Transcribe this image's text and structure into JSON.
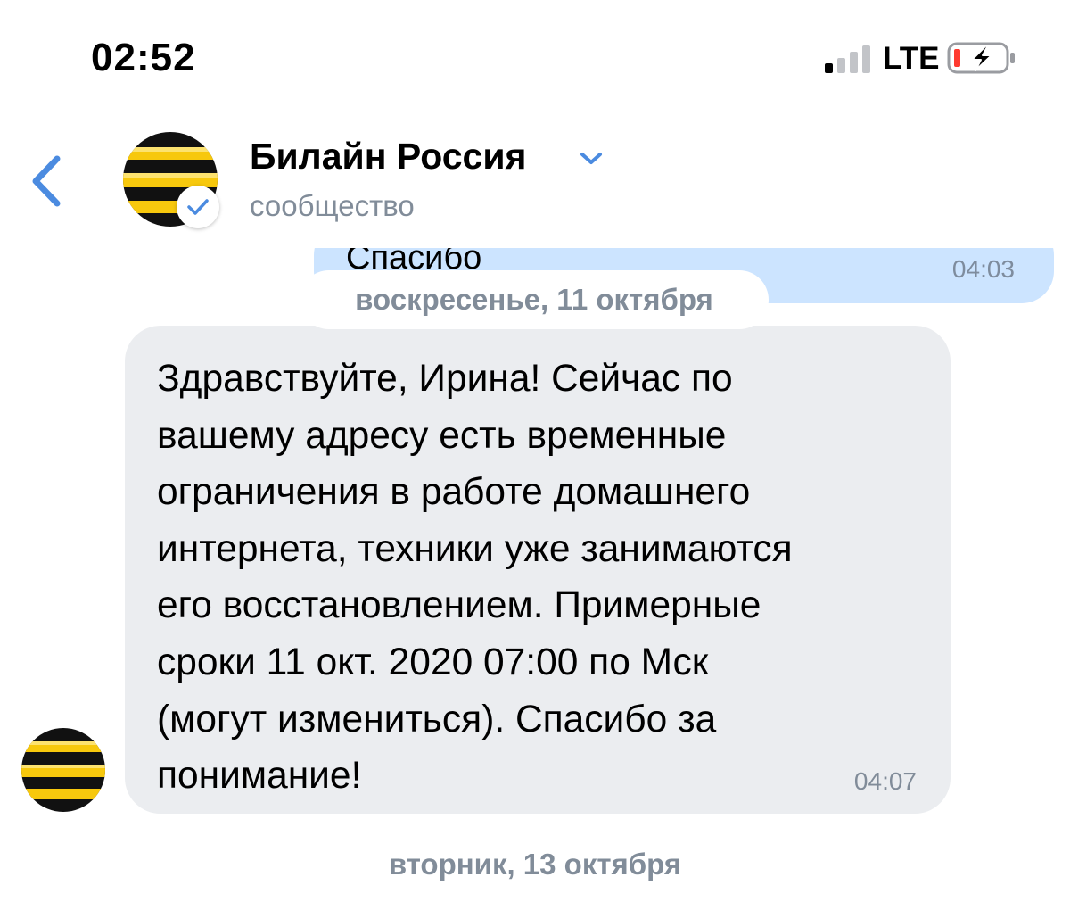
{
  "status_bar": {
    "time": "02:52",
    "network": "LTE",
    "signal_bars_active": 1,
    "signal_bars_total": 4,
    "battery_charging": true
  },
  "header": {
    "title": "Билайн Россия",
    "subtitle": "сообщество",
    "verified": true,
    "back_icon": "chevron-left-icon",
    "title_icon": "chevron-down-icon"
  },
  "messages": {
    "previous_outgoing": {
      "text": "Спасибо",
      "time": "04:03"
    },
    "date_chip": "воскресенье, 11 октября",
    "incoming": {
      "text": "Здравствуйте, Ирина! Сейчас по\nвашему адресу есть временные\nограничения в работе домашнего\nинтернета, техники уже занимаются\nего восстановлением. Примерные\nсроки 11 окт. 2020 07:00 по Мск\n(могут измениться). Спасибо за\nпонимание!",
      "time": "04:07"
    },
    "next_date_separator": "вторник, 13 октября"
  },
  "colors": {
    "accent": "#4b8be0",
    "outgoing_bubble": "#cce4ff",
    "incoming_bubble": "#ebedf0",
    "secondary_text": "#818c99",
    "beeline_yellow": "#f7c80d",
    "beeline_black": "#111111"
  }
}
